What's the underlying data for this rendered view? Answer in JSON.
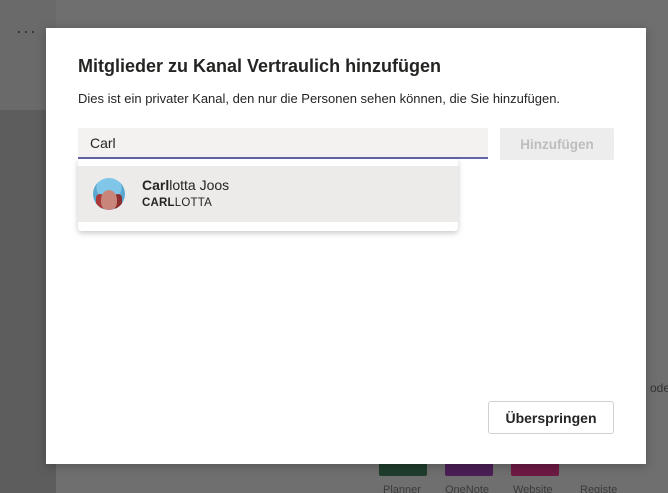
{
  "background": {
    "more_glyph": "···",
    "right_edge_text": "ode",
    "app_tiles": [
      {
        "label": "Planner",
        "color": "#1f3d2c"
      },
      {
        "label": "OneNote",
        "color": "#4a1f55"
      },
      {
        "label": "Website",
        "color": "#6e1a44"
      },
      {
        "label": "Registe",
        "color": "#000000"
      }
    ]
  },
  "dialog": {
    "title": "Mitglieder zu Kanal Vertraulich hinzufügen",
    "subtitle": "Dies ist ein privater Kanal, den nur die Personen sehen können, die Sie hinzufügen.",
    "search": {
      "value": "Carl",
      "placeholder": ""
    },
    "add_label": "Hinzufügen",
    "suggestions": [
      {
        "name_match": "Carl",
        "name_rest": "lotta Joos",
        "sub_match": "CARL",
        "sub_rest": "LOTTA",
        "avatar": "avatar-photo"
      }
    ],
    "skip_label": "Überspringen"
  },
  "colors": {
    "accent": "#6264a7",
    "overlay": "#6f6f6f",
    "input_bg": "#f3f2f1",
    "hover_bg": "#edebe9"
  }
}
